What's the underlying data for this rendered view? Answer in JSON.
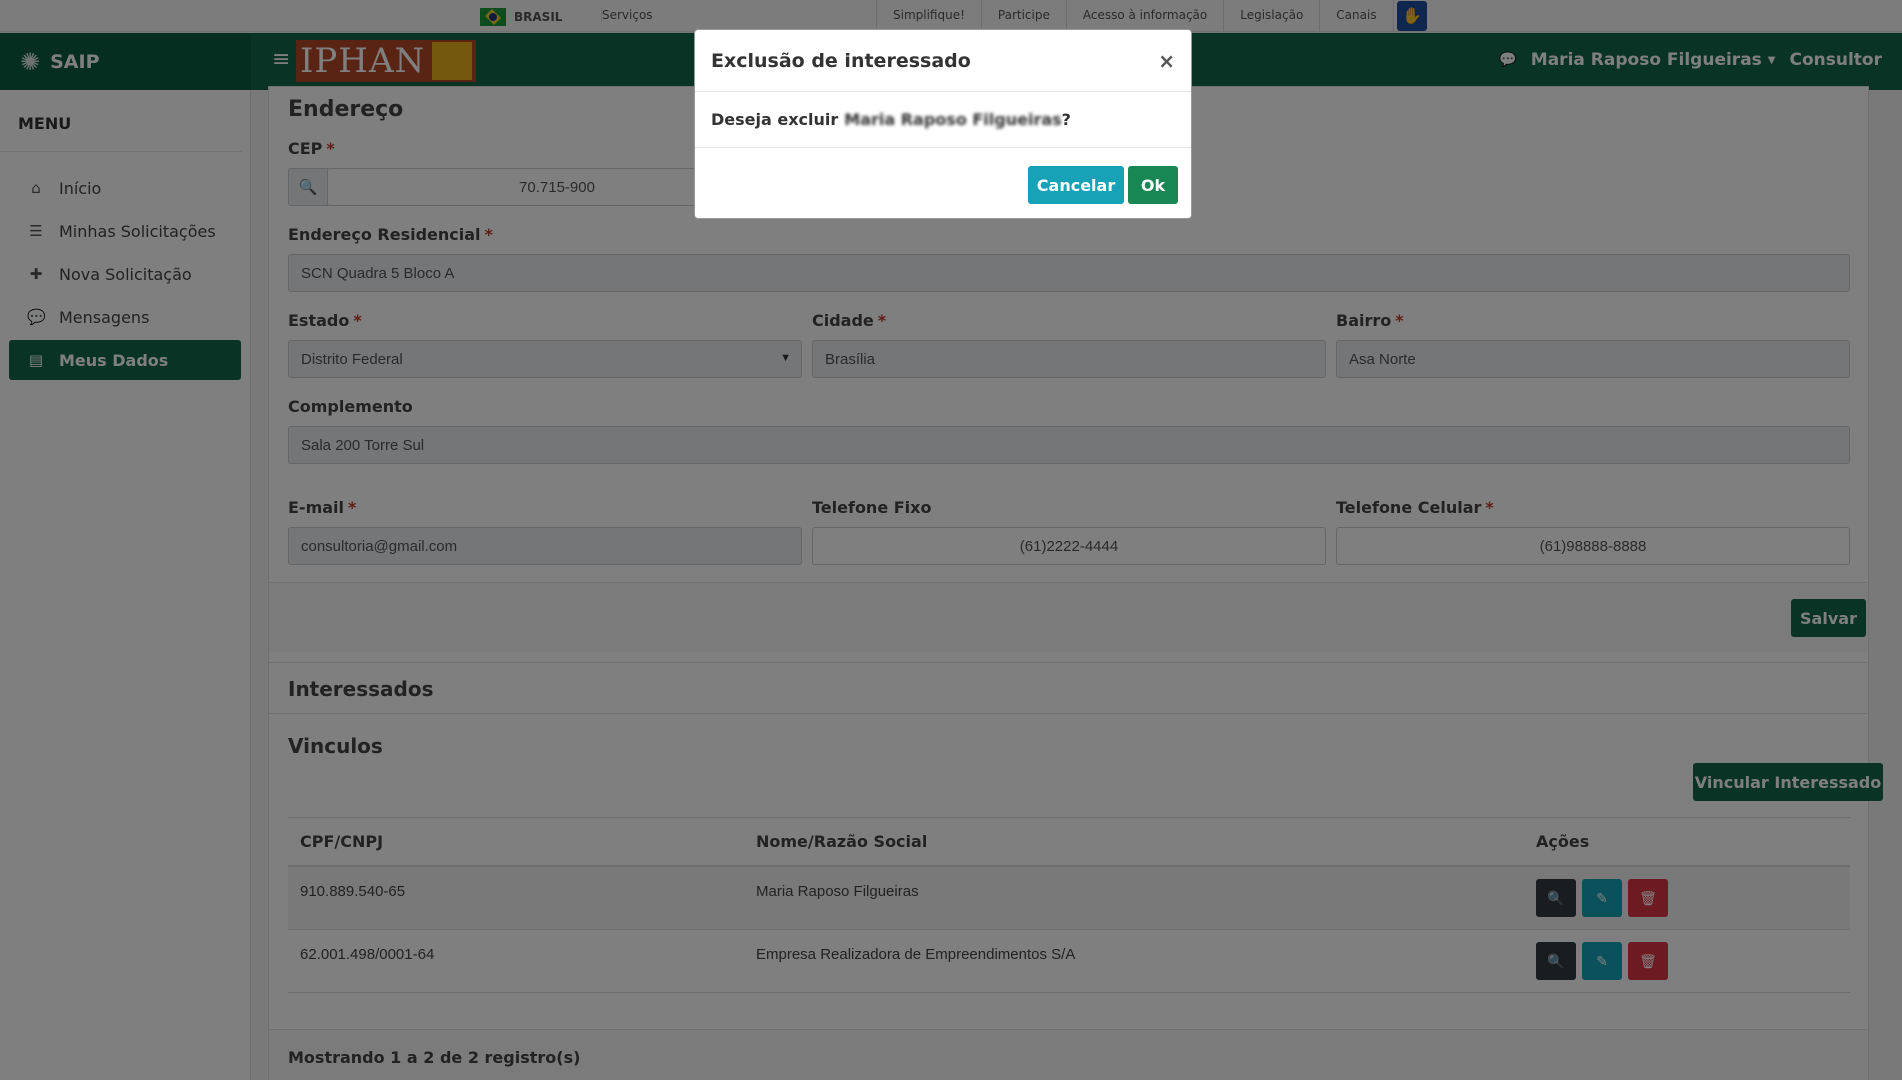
{
  "govbar": {
    "country": "BRASIL",
    "services": "Serviços",
    "links": [
      "Simplifique!",
      "Participe",
      "Acesso à informação",
      "Legislação",
      "Canais"
    ]
  },
  "header": {
    "app_name": "SAIP",
    "logo_text": "IPHAN",
    "user_name": "Maria Raposo Filgueiras",
    "role": "Consultor"
  },
  "sidebar": {
    "title": "MENU",
    "items": [
      {
        "label": "Início",
        "icon": "home-icon"
      },
      {
        "label": "Minhas Solicitações",
        "icon": "list-icon"
      },
      {
        "label": "Nova Solicitação",
        "icon": "plus-icon"
      },
      {
        "label": "Mensagens",
        "icon": "chat-icon"
      },
      {
        "label": "Meus Dados",
        "icon": "file-icon",
        "active": true
      }
    ]
  },
  "address": {
    "section_title": "Endereço",
    "cep_label": "CEP",
    "cep_value": "70.715-900",
    "street_label": "Endereço Residencial",
    "street_value": "SCN Quadra 5 Bloco A",
    "state_label": "Estado",
    "state_value": "Distrito Federal",
    "city_label": "Cidade",
    "city_value": "Brasília",
    "district_label": "Bairro",
    "district_value": "Asa Norte",
    "complement_label": "Complemento",
    "complement_value": "Sala 200 Torre Sul",
    "email_label": "E-mail",
    "email_value": "consultoria@gmail.com",
    "phone_label": "Telefone Fixo",
    "phone_value": "(61)2222-4444",
    "mobile_label": "Telefone Celular",
    "mobile_value": "(61)98888-8888",
    "save_label": "Salvar"
  },
  "interested": {
    "section_title": "Interessados",
    "links_title": "Vinculos",
    "link_button": "Vincular Interessado",
    "columns": [
      "CPF/CNPJ",
      "Nome/Razão Social",
      "Ações"
    ],
    "rows": [
      {
        "doc": "910.889.540-65",
        "name": "Maria Raposo Filgueiras"
      },
      {
        "doc": "62.001.498/0001-64",
        "name": "Empresa Realizadora de Empreendimentos S/A"
      }
    ],
    "records_text": "Mostrando 1 a 2 de 2 registro(s)"
  },
  "modal": {
    "title": "Exclusão de interessado",
    "close": "×",
    "question_prefix": "Deseja excluir",
    "question_name": "Maria Raposo Filgueiras",
    "question_suffix": "?",
    "cancel_label": "Cancelar",
    "ok_label": "Ok"
  },
  "colors": {
    "primary_green": "#10664a",
    "teal": "#17a2b8",
    "danger": "#dc3545"
  }
}
